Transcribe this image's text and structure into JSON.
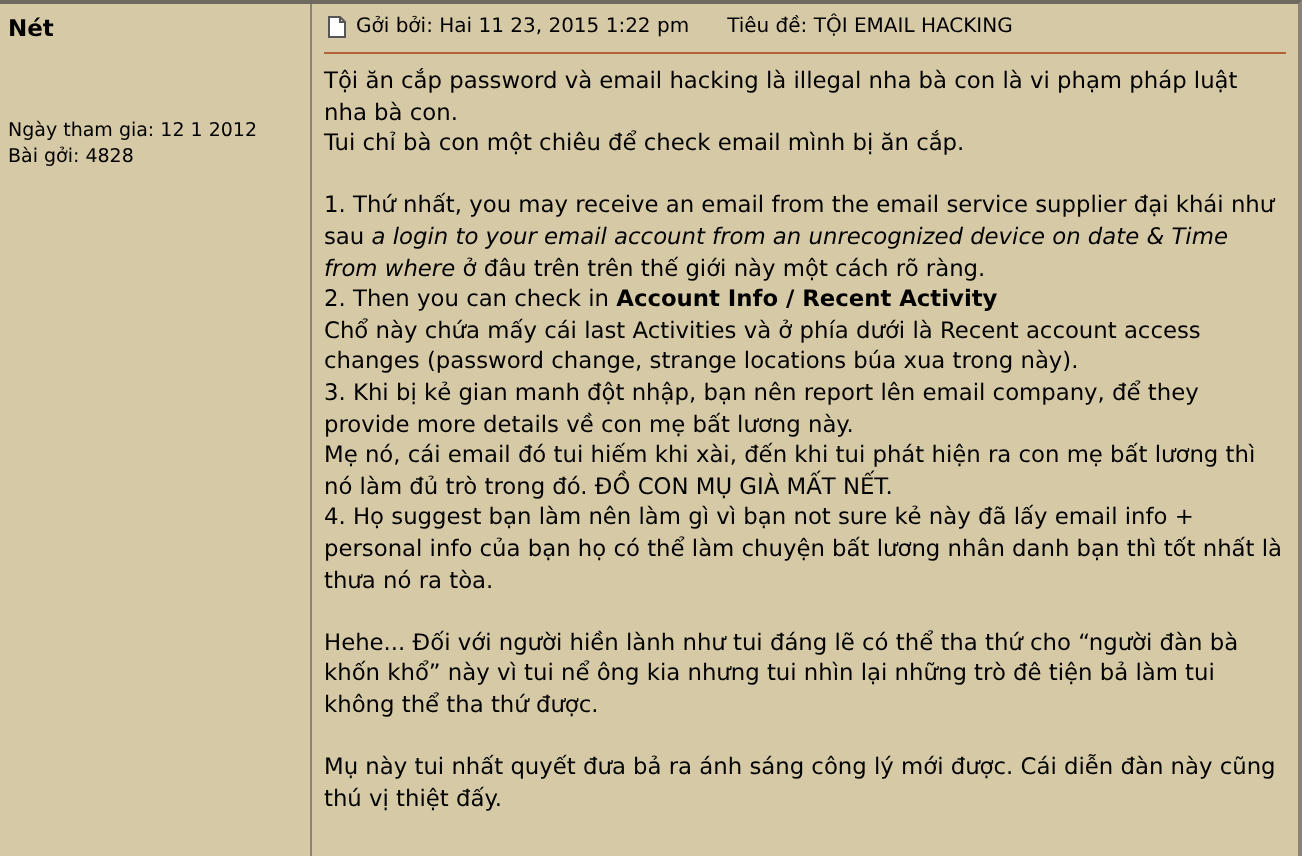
{
  "author": {
    "name": "Nét",
    "joined": "Ngày tham gia: 12 1 2012",
    "posts": "Bài gởi: 4828"
  },
  "post_header": {
    "posted": "Gởi bởi: Hai 11 23, 2015 1:22 pm",
    "subject": "Tiêu đề: TỘI EMAIL HACKING"
  },
  "body": [
    [
      "Tội ăn cắp password và email hacking là illegal nha bà con là vi phạm pháp luật nha bà con.",
      "Tui chỉ bà con một chiêu để check email mình bị ăn cắp."
    ],
    [
      "1. Thứ nhất, you may receive an email from the email service supplier đại khái như sau *a login to your email account from an unrecognized device on date & Time from where* ở đâu trên trên thế giới này một cách rõ ràng.",
      "2. Then you can check in **Account Info / Recent Activity**",
      "Chổ này chứa mấy cái last Activities và ở phía dưới là Recent account access changes (password change, strange locations búa xua trong này).",
      "3. Khi bị kẻ gian manh đột nhập, bạn nên report lên email company, để they provide more details về con mẹ bất lương này.",
      "Mẹ nó, cái email đó tui hiếm khi xài, đến khi tui phát hiện ra con mẹ bất lương thì nó làm đủ trò trong đó. ĐỒ CON MỤ GIÀ MẤT NẾT.",
      "4. Họ suggest bạn làm nên làm gì vì bạn not sure kẻ này đã lấy email info + personal info của bạn họ có thể làm chuyện bất lương nhân danh bạn thì tốt nhất là thưa nó ra tòa."
    ],
    [
      "Hehe... Đối với người hiền lành như tui đáng lẽ có thể tha thứ cho “người đàn bà khốn khổ” này vì tui nể ông kia nhưng tui nhìn lại những trò đê tiện bả làm tui không thể tha thứ được."
    ],
    [
      "Mụ này tui nhất quyết đưa bả ra ánh sáng công lý mới được. Cái diễn đàn này cũng thú vị thiệt đấy."
    ]
  ]
}
